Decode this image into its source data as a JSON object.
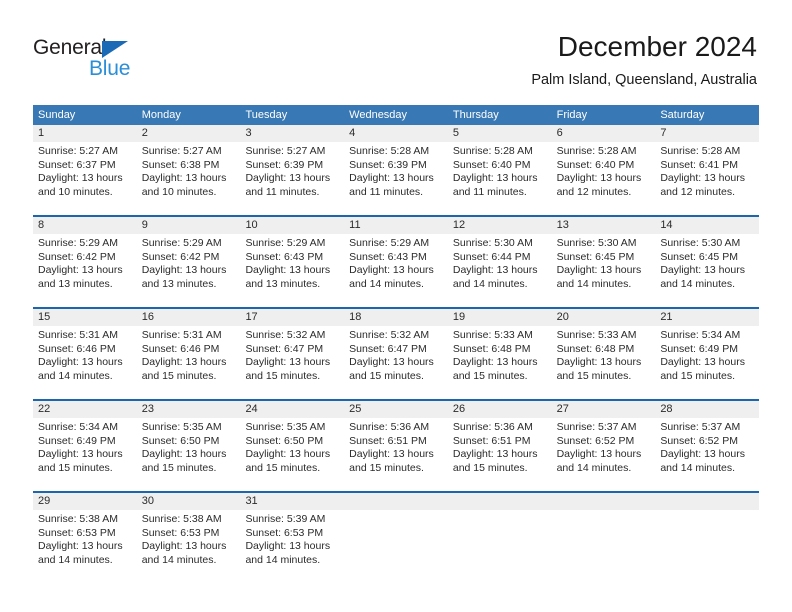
{
  "brand": {
    "name_top": "General",
    "name_bottom": "Blue"
  },
  "header": {
    "title": "December 2024",
    "subtitle": "Palm Island, Queensland, Australia"
  },
  "colors": {
    "header_blue": "#3878b4",
    "week_rule_blue": "#1b66ad",
    "daynum_band": "#efefef",
    "logo_blue": "#2a8fd8",
    "logo_triangle": "#1b6ab5"
  },
  "weekdays": [
    "Sunday",
    "Monday",
    "Tuesday",
    "Wednesday",
    "Thursday",
    "Friday",
    "Saturday"
  ],
  "weeks": [
    [
      {
        "day": "1",
        "sunrise": "Sunrise: 5:27 AM",
        "sunset": "Sunset: 6:37 PM",
        "daylight1": "Daylight: 13 hours",
        "daylight2": "and 10 minutes."
      },
      {
        "day": "2",
        "sunrise": "Sunrise: 5:27 AM",
        "sunset": "Sunset: 6:38 PM",
        "daylight1": "Daylight: 13 hours",
        "daylight2": "and 10 minutes."
      },
      {
        "day": "3",
        "sunrise": "Sunrise: 5:27 AM",
        "sunset": "Sunset: 6:39 PM",
        "daylight1": "Daylight: 13 hours",
        "daylight2": "and 11 minutes."
      },
      {
        "day": "4",
        "sunrise": "Sunrise: 5:28 AM",
        "sunset": "Sunset: 6:39 PM",
        "daylight1": "Daylight: 13 hours",
        "daylight2": "and 11 minutes."
      },
      {
        "day": "5",
        "sunrise": "Sunrise: 5:28 AM",
        "sunset": "Sunset: 6:40 PM",
        "daylight1": "Daylight: 13 hours",
        "daylight2": "and 11 minutes."
      },
      {
        "day": "6",
        "sunrise": "Sunrise: 5:28 AM",
        "sunset": "Sunset: 6:40 PM",
        "daylight1": "Daylight: 13 hours",
        "daylight2": "and 12 minutes."
      },
      {
        "day": "7",
        "sunrise": "Sunrise: 5:28 AM",
        "sunset": "Sunset: 6:41 PM",
        "daylight1": "Daylight: 13 hours",
        "daylight2": "and 12 minutes."
      }
    ],
    [
      {
        "day": "8",
        "sunrise": "Sunrise: 5:29 AM",
        "sunset": "Sunset: 6:42 PM",
        "daylight1": "Daylight: 13 hours",
        "daylight2": "and 13 minutes."
      },
      {
        "day": "9",
        "sunrise": "Sunrise: 5:29 AM",
        "sunset": "Sunset: 6:42 PM",
        "daylight1": "Daylight: 13 hours",
        "daylight2": "and 13 minutes."
      },
      {
        "day": "10",
        "sunrise": "Sunrise: 5:29 AM",
        "sunset": "Sunset: 6:43 PM",
        "daylight1": "Daylight: 13 hours",
        "daylight2": "and 13 minutes."
      },
      {
        "day": "11",
        "sunrise": "Sunrise: 5:29 AM",
        "sunset": "Sunset: 6:43 PM",
        "daylight1": "Daylight: 13 hours",
        "daylight2": "and 14 minutes."
      },
      {
        "day": "12",
        "sunrise": "Sunrise: 5:30 AM",
        "sunset": "Sunset: 6:44 PM",
        "daylight1": "Daylight: 13 hours",
        "daylight2": "and 14 minutes."
      },
      {
        "day": "13",
        "sunrise": "Sunrise: 5:30 AM",
        "sunset": "Sunset: 6:45 PM",
        "daylight1": "Daylight: 13 hours",
        "daylight2": "and 14 minutes."
      },
      {
        "day": "14",
        "sunrise": "Sunrise: 5:30 AM",
        "sunset": "Sunset: 6:45 PM",
        "daylight1": "Daylight: 13 hours",
        "daylight2": "and 14 minutes."
      }
    ],
    [
      {
        "day": "15",
        "sunrise": "Sunrise: 5:31 AM",
        "sunset": "Sunset: 6:46 PM",
        "daylight1": "Daylight: 13 hours",
        "daylight2": "and 14 minutes."
      },
      {
        "day": "16",
        "sunrise": "Sunrise: 5:31 AM",
        "sunset": "Sunset: 6:46 PM",
        "daylight1": "Daylight: 13 hours",
        "daylight2": "and 15 minutes."
      },
      {
        "day": "17",
        "sunrise": "Sunrise: 5:32 AM",
        "sunset": "Sunset: 6:47 PM",
        "daylight1": "Daylight: 13 hours",
        "daylight2": "and 15 minutes."
      },
      {
        "day": "18",
        "sunrise": "Sunrise: 5:32 AM",
        "sunset": "Sunset: 6:47 PM",
        "daylight1": "Daylight: 13 hours",
        "daylight2": "and 15 minutes."
      },
      {
        "day": "19",
        "sunrise": "Sunrise: 5:33 AM",
        "sunset": "Sunset: 6:48 PM",
        "daylight1": "Daylight: 13 hours",
        "daylight2": "and 15 minutes."
      },
      {
        "day": "20",
        "sunrise": "Sunrise: 5:33 AM",
        "sunset": "Sunset: 6:48 PM",
        "daylight1": "Daylight: 13 hours",
        "daylight2": "and 15 minutes."
      },
      {
        "day": "21",
        "sunrise": "Sunrise: 5:34 AM",
        "sunset": "Sunset: 6:49 PM",
        "daylight1": "Daylight: 13 hours",
        "daylight2": "and 15 minutes."
      }
    ],
    [
      {
        "day": "22",
        "sunrise": "Sunrise: 5:34 AM",
        "sunset": "Sunset: 6:49 PM",
        "daylight1": "Daylight: 13 hours",
        "daylight2": "and 15 minutes."
      },
      {
        "day": "23",
        "sunrise": "Sunrise: 5:35 AM",
        "sunset": "Sunset: 6:50 PM",
        "daylight1": "Daylight: 13 hours",
        "daylight2": "and 15 minutes."
      },
      {
        "day": "24",
        "sunrise": "Sunrise: 5:35 AM",
        "sunset": "Sunset: 6:50 PM",
        "daylight1": "Daylight: 13 hours",
        "daylight2": "and 15 minutes."
      },
      {
        "day": "25",
        "sunrise": "Sunrise: 5:36 AM",
        "sunset": "Sunset: 6:51 PM",
        "daylight1": "Daylight: 13 hours",
        "daylight2": "and 15 minutes."
      },
      {
        "day": "26",
        "sunrise": "Sunrise: 5:36 AM",
        "sunset": "Sunset: 6:51 PM",
        "daylight1": "Daylight: 13 hours",
        "daylight2": "and 15 minutes."
      },
      {
        "day": "27",
        "sunrise": "Sunrise: 5:37 AM",
        "sunset": "Sunset: 6:52 PM",
        "daylight1": "Daylight: 13 hours",
        "daylight2": "and 14 minutes."
      },
      {
        "day": "28",
        "sunrise": "Sunrise: 5:37 AM",
        "sunset": "Sunset: 6:52 PM",
        "daylight1": "Daylight: 13 hours",
        "daylight2": "and 14 minutes."
      }
    ],
    [
      {
        "day": "29",
        "sunrise": "Sunrise: 5:38 AM",
        "sunset": "Sunset: 6:53 PM",
        "daylight1": "Daylight: 13 hours",
        "daylight2": "and 14 minutes."
      },
      {
        "day": "30",
        "sunrise": "Sunrise: 5:38 AM",
        "sunset": "Sunset: 6:53 PM",
        "daylight1": "Daylight: 13 hours",
        "daylight2": "and 14 minutes."
      },
      {
        "day": "31",
        "sunrise": "Sunrise: 5:39 AM",
        "sunset": "Sunset: 6:53 PM",
        "daylight1": "Daylight: 13 hours",
        "daylight2": "and 14 minutes."
      },
      {
        "day": "",
        "sunrise": "",
        "sunset": "",
        "daylight1": "",
        "daylight2": ""
      },
      {
        "day": "",
        "sunrise": "",
        "sunset": "",
        "daylight1": "",
        "daylight2": ""
      },
      {
        "day": "",
        "sunrise": "",
        "sunset": "",
        "daylight1": "",
        "daylight2": ""
      },
      {
        "day": "",
        "sunrise": "",
        "sunset": "",
        "daylight1": "",
        "daylight2": ""
      }
    ]
  ]
}
